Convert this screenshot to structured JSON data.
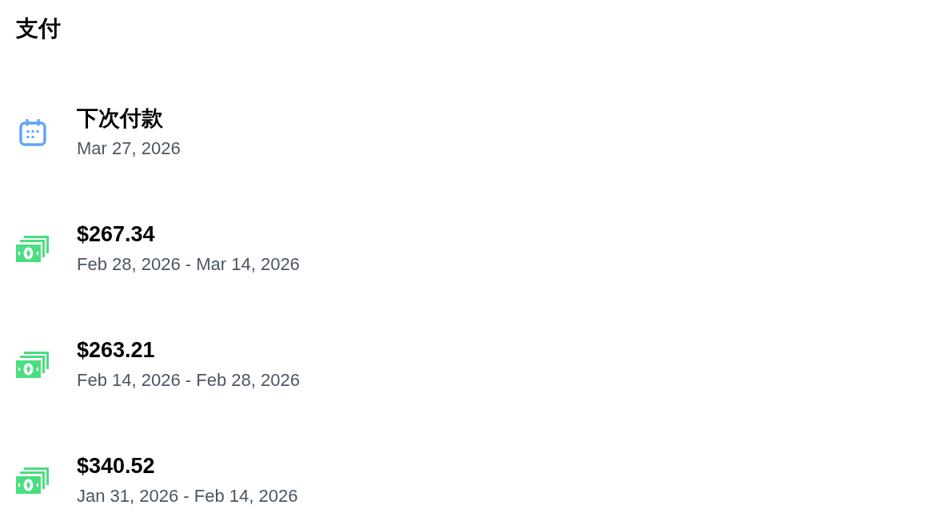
{
  "header": {
    "title": "支付"
  },
  "items": [
    {
      "kind": "schedule",
      "title": "下次付款",
      "subtitle": "Mar 27, 2026"
    },
    {
      "kind": "payment",
      "title": "$267.34",
      "subtitle": "Feb 28, 2026 - Mar 14, 2026"
    },
    {
      "kind": "payment",
      "title": "$263.21",
      "subtitle": "Feb 14, 2026 - Feb 28, 2026"
    },
    {
      "kind": "payment",
      "title": "$340.52",
      "subtitle": "Jan 31, 2026 - Feb 14, 2026"
    }
  ]
}
